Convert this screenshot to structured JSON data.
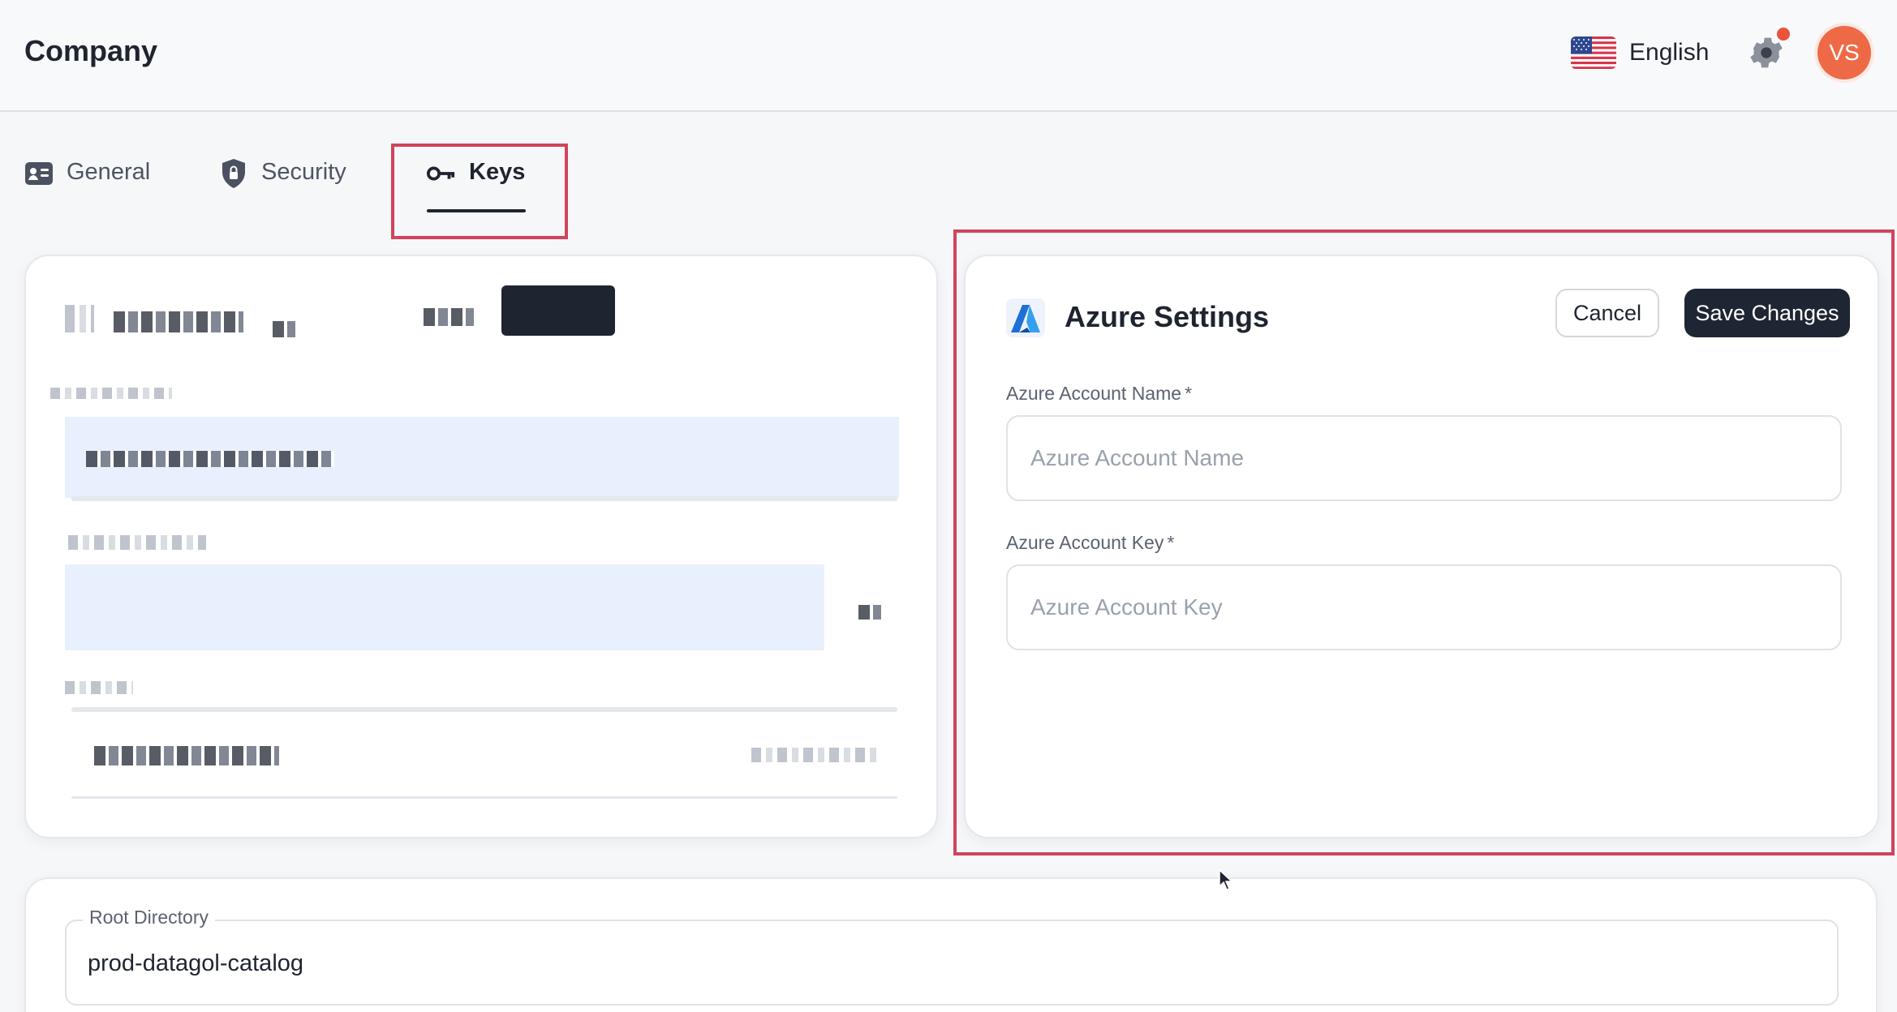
{
  "header": {
    "title": "Company",
    "language": "English",
    "avatar_initials": "VS",
    "accent_notification": "#e8533a"
  },
  "tabs": [
    {
      "label": "General",
      "icon": "id-card-icon"
    },
    {
      "label": "Security",
      "icon": "shield-lock-icon"
    },
    {
      "label": "Keys",
      "icon": "key-icon",
      "active": true
    }
  ],
  "azure": {
    "title": "Azure Settings",
    "cancel_label": "Cancel",
    "save_label": "Save Changes",
    "account_name_label": "Azure Account Name",
    "account_name_placeholder": "Azure Account Name",
    "account_key_label": "Azure Account Key",
    "account_key_placeholder": "Azure Account Key",
    "required_mark": "*"
  },
  "root": {
    "label": "Root Directory",
    "value": "prod-datagol-catalog"
  },
  "colors": {
    "highlight": "#d0445c",
    "primary_button": "#1e2633",
    "avatar": "#ee6a47"
  }
}
